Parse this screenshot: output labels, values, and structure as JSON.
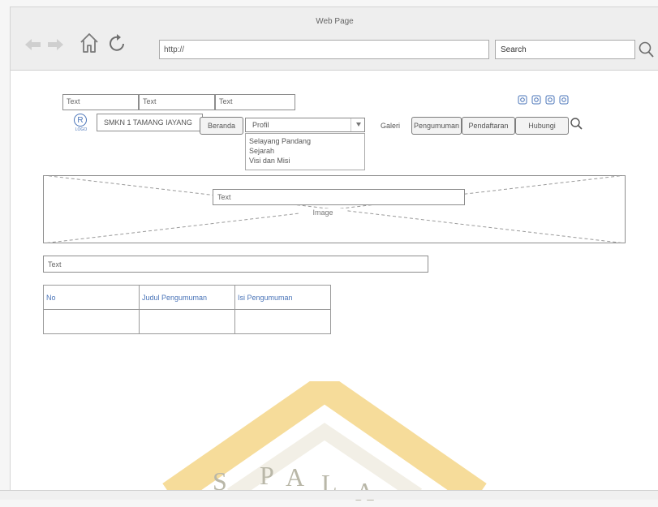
{
  "window": {
    "title": "Web Page"
  },
  "browser": {
    "url": "http://",
    "search": "Search",
    "icons": [
      "back-arrow-icon",
      "forward-arrow-icon",
      "home-icon",
      "reload-icon",
      "magnifier-icon"
    ]
  },
  "top_fields": [
    "Text",
    "Text",
    "Text"
  ],
  "social_icons": [
    "social-icon",
    "social-icon",
    "social-icon",
    "social-icon"
  ],
  "logo": {
    "mark": "R",
    "caption": "LOGO"
  },
  "school_name": "SMKN 1 TAMANG IAYANG",
  "nav": {
    "beranda": "Beranda",
    "profil": "Profil",
    "galeri": "Galeri",
    "pengumuman": "Pengumuman",
    "pendaftaran": "Pendaftaran",
    "hubungi": "Hubungi"
  },
  "profil_menu": [
    "Selayang Pandang",
    "Sejarah",
    "Visi dan Misi"
  ],
  "banner": {
    "text": "Text",
    "image_label": "Image"
  },
  "main_text": "Text",
  "table": {
    "headers": [
      "No",
      "Judul Pengumuman",
      "Isi Pengumuman"
    ],
    "rows": [
      [
        "",
        "",
        ""
      ]
    ]
  },
  "watermark": {
    "letters": [
      "S",
      "P",
      "A",
      "L",
      "A"
    ]
  },
  "colors": {
    "link_blue": "#4a74b8",
    "frame_gray": "#eeeeee",
    "watermark": "#f2b92e"
  }
}
